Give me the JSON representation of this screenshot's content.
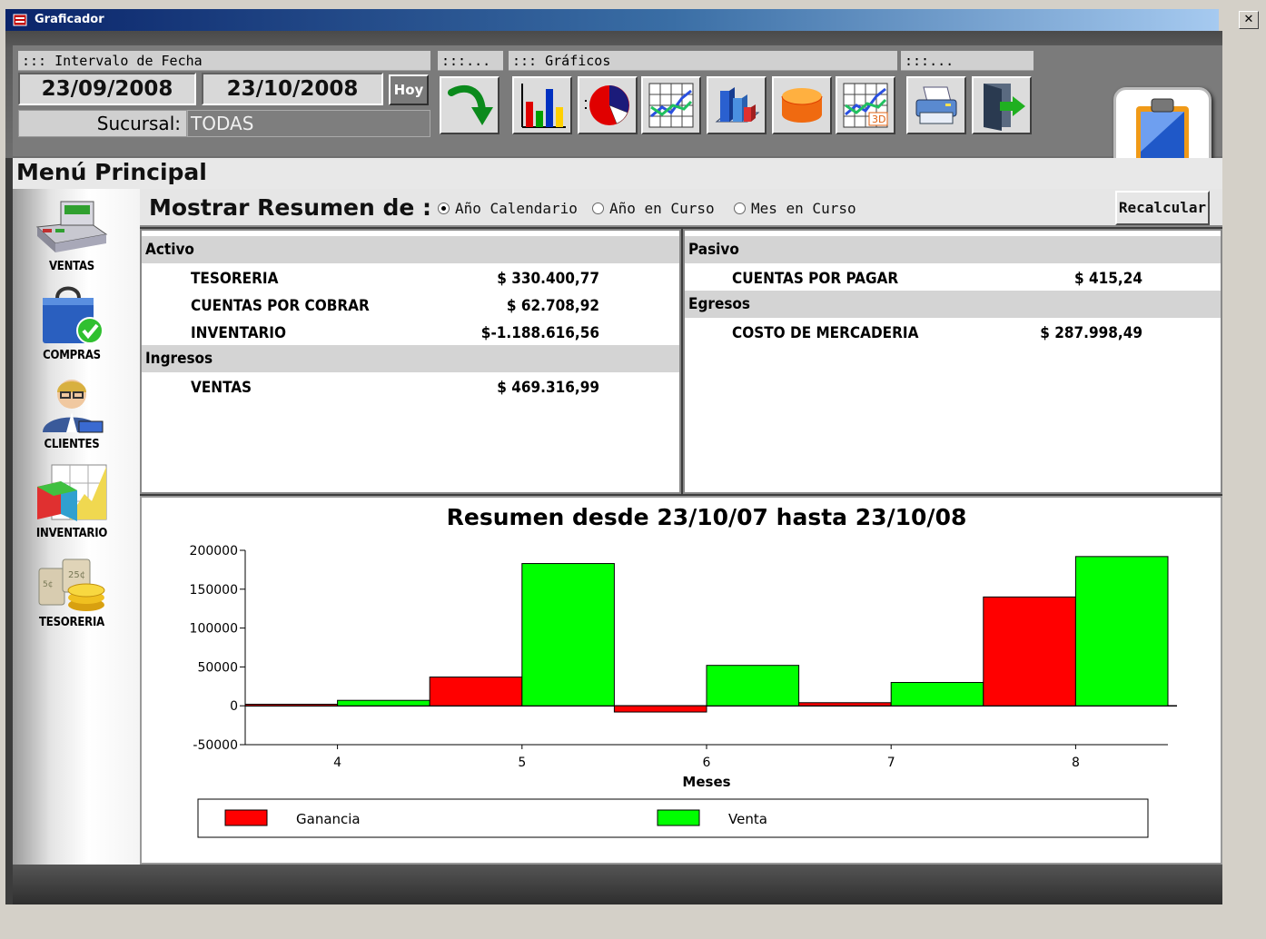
{
  "window": {
    "title": "Graficador",
    "close_label": "✕"
  },
  "date_range": {
    "caption": "::: Intervalo de Fecha",
    "from": "23/09/2008",
    "to": "23/10/2008",
    "today_label": "Hoy",
    "branch_label": "Sucursal:",
    "branch_value": "TODAS"
  },
  "toolbar": {
    "group1_caption": ":::...",
    "graficos_caption": "::: Gráficos",
    "group3_caption": ":::...",
    "buttons": [
      "arrow-refresh-icon",
      "bar-chart-icon",
      "pie-chart-icon",
      "line-chart-icon",
      "bar-chart-3d-icon",
      "cylinder-icon",
      "line-chart-3d-icon",
      "printer-icon",
      "exit-door-icon"
    ]
  },
  "menu_title": "Menú Principal",
  "sidebar": {
    "items": [
      {
        "label": "VENTAS",
        "icon": "cash-register-icon"
      },
      {
        "label": "COMPRAS",
        "icon": "shopping-bag-icon"
      },
      {
        "label": "CLIENTES",
        "icon": "client-person-icon"
      },
      {
        "label": "INVENTARIO",
        "icon": "inventory-box-icon"
      },
      {
        "label": "TESORERIA",
        "icon": "coins-icon"
      }
    ]
  },
  "summary": {
    "lead": "Mostrar Resumen de :",
    "options": [
      "Año Calendario",
      "Año en Curso",
      "Mes en Curso"
    ],
    "selected": "Año Calendario",
    "recalc_label": "Recalcular"
  },
  "accounts": {
    "left": {
      "activo_title": "Activo",
      "activo": [
        {
          "name": "TESORERIA",
          "value": "$ 330.400,77"
        },
        {
          "name": "CUENTAS POR COBRAR",
          "value": "$ 62.708,92"
        },
        {
          "name": "INVENTARIO",
          "value": "$-1.188.616,56"
        }
      ],
      "ingresos_title": "Ingresos",
      "ingresos": [
        {
          "name": "VENTAS",
          "value": "$ 469.316,99"
        }
      ]
    },
    "right": {
      "pasivo_title": "Pasivo",
      "pasivo": [
        {
          "name": "CUENTAS POR PAGAR",
          "value": "$ 415,24"
        }
      ],
      "egresos_title": "Egresos",
      "egresos": [
        {
          "name": "COSTO DE MERCADERIA",
          "value": "$ 287.998,49"
        }
      ]
    }
  },
  "chart_data": {
    "type": "bar",
    "title": "Resumen desde 23/10/07 hasta 23/10/08",
    "xlabel": "Meses",
    "ylabel": "",
    "categories": [
      "4",
      "5",
      "6",
      "7",
      "8"
    ],
    "ylim": [
      -50000,
      200000
    ],
    "yticks": [
      -50000,
      0,
      50000,
      100000,
      150000,
      200000
    ],
    "series": [
      {
        "name": "Ganancia",
        "color": "#ff0000",
        "values": [
          2000,
          37000,
          -8000,
          4000,
          140000
        ]
      },
      {
        "name": "Venta",
        "color": "#00ff00",
        "values": [
          7000,
          183000,
          52000,
          30000,
          192000
        ]
      }
    ],
    "legend": "bottom",
    "grid": false
  }
}
